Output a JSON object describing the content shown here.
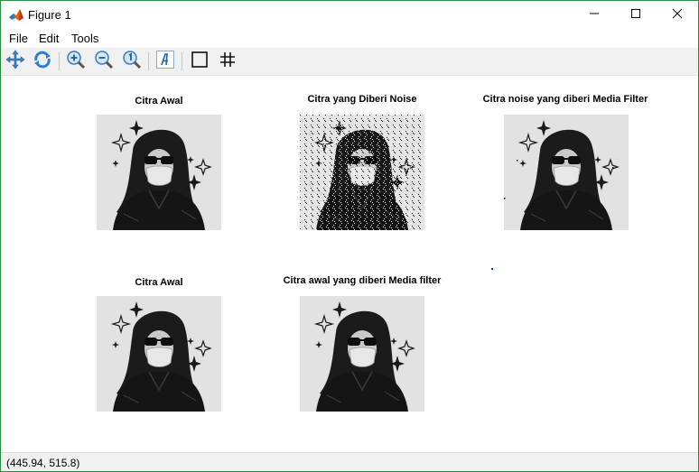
{
  "window": {
    "title": "Figure 1",
    "app_icon": "matlab-logo-icon",
    "controls": [
      "minimize-icon",
      "maximize-icon",
      "close-icon"
    ]
  },
  "menu": {
    "items": [
      {
        "label": "File"
      },
      {
        "label": "Edit"
      },
      {
        "label": "Tools"
      }
    ]
  },
  "toolbar": {
    "tools": [
      "pan-icon",
      "rotate-3d-icon",
      "zoom-in-icon",
      "zoom-out-icon",
      "zoom-reset-icon",
      "insert-text-icon",
      "box-icon",
      "grid-icon"
    ]
  },
  "figure": {
    "subplots": [
      {
        "title": "Citra Awal",
        "image": "original-portrait",
        "noise": false
      },
      {
        "title": "Citra yang Diberi Noise",
        "image": "noisy-portrait",
        "noise": true
      },
      {
        "title": "Citra noise yang diberi Media Filter",
        "image": "median-filtered-portrait",
        "noise": false
      },
      {
        "title": "Citra Awal",
        "image": "original-portrait",
        "noise": false
      },
      {
        "title": "Citra awal yang diberi Media filter",
        "image": "median-filtered-original-portrait",
        "noise": false
      }
    ]
  },
  "status": {
    "coordinates": "(445.94, 515.8)"
  }
}
